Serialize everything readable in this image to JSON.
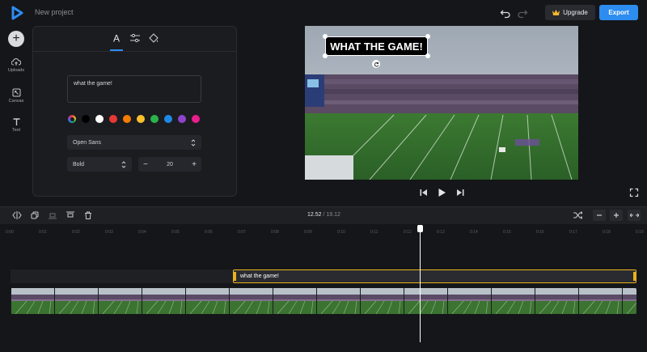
{
  "app": {
    "project_title": "New project"
  },
  "header": {
    "upgrade_label": "Upgrade",
    "export_label": "Export",
    "upgrade_icon": "crown-icon"
  },
  "sidebar": {
    "items": [
      {
        "label": "Uploads",
        "icon": "cloud-upload-icon"
      },
      {
        "label": "Canvas",
        "icon": "canvas-icon"
      },
      {
        "label": "Text",
        "icon": "text-icon"
      }
    ]
  },
  "text_panel": {
    "tabs": [
      {
        "icon": "font-icon"
      },
      {
        "icon": "sliders-icon"
      },
      {
        "icon": "paint-bucket-icon"
      }
    ],
    "text_value": "what the game!",
    "colors": [
      "#ffffff",
      "#000000",
      "#ffffff",
      "#e53935",
      "#f57c00",
      "#fbc02d",
      "#2bb34b",
      "#1e88e5",
      "#8e44c8",
      "#e91e8c"
    ],
    "font_family": "Open Sans",
    "font_weight": "Bold",
    "font_size": "20",
    "minus_label": "−",
    "plus_label": "+"
  },
  "preview": {
    "caption": "WHAT THE GAME!"
  },
  "timeline": {
    "current_time": "12.52",
    "separator": "/",
    "total_time": "19.12",
    "ticks": [
      "0:00",
      "0:01",
      "0:02",
      "0:03",
      "0:04",
      "0:05",
      "0:06",
      "0:07",
      "0:08",
      "0:09",
      "0:10",
      "0:11",
      "0:12",
      "0:13",
      "0:14",
      "0:15",
      "0:16",
      "0:17",
      "0:18",
      "0:19"
    ],
    "text_clip_label": "what the game!"
  },
  "colors": {
    "accent": "#2d8cf0",
    "clip_border": "#e8b21b",
    "background": "#151619"
  }
}
